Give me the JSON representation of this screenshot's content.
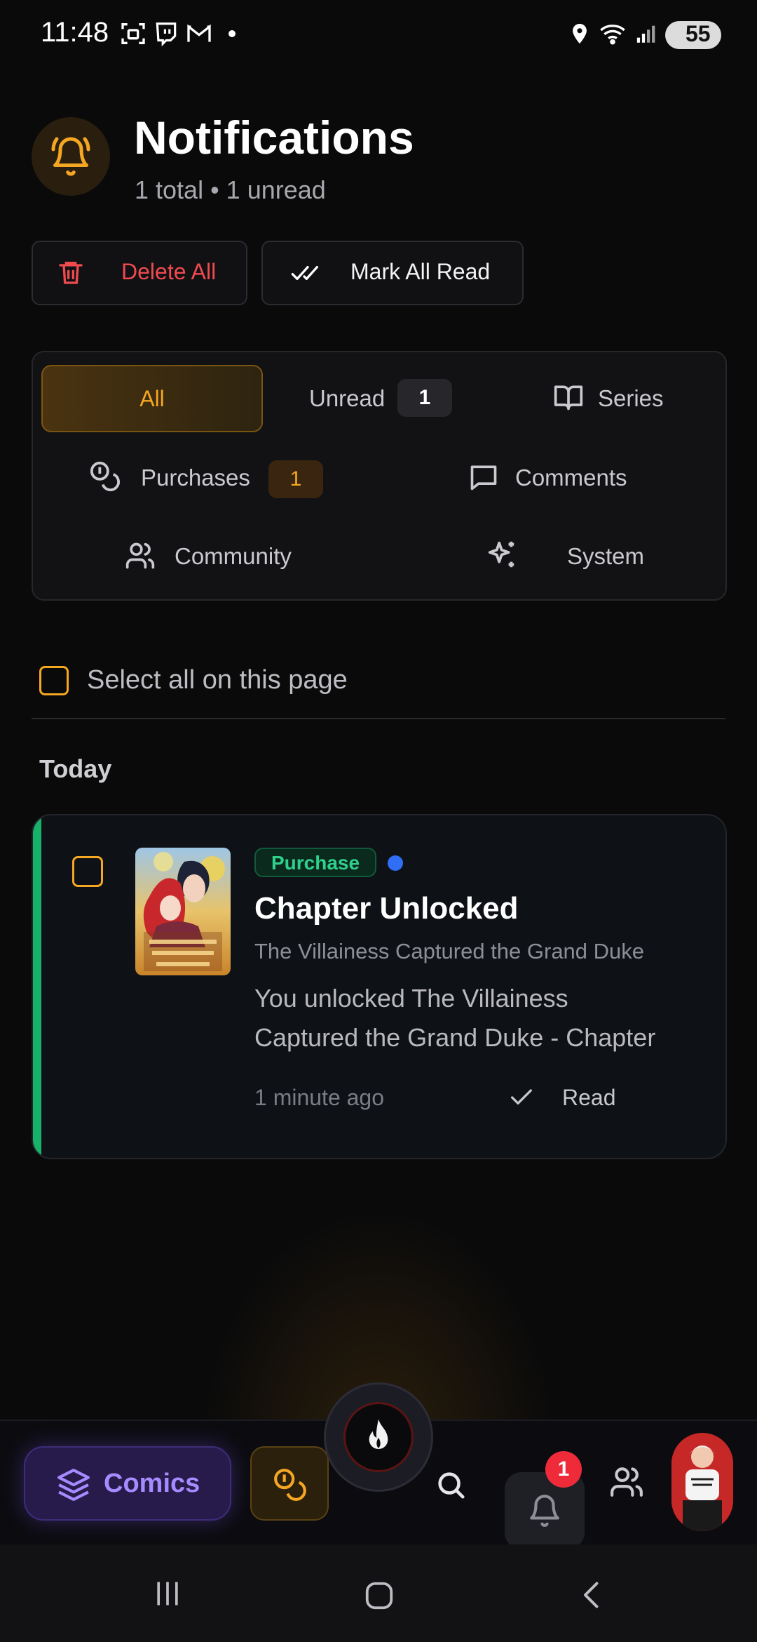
{
  "status_bar": {
    "time": "11:48",
    "battery": "55"
  },
  "header": {
    "title": "Notifications",
    "subtitle": "1 total • 1 unread"
  },
  "actions": {
    "delete_all": "Delete All",
    "mark_all_read": "Mark All Read"
  },
  "filters": {
    "all": "All",
    "unread": {
      "label": "Unread",
      "count": "1"
    },
    "series": "Series",
    "purchases": {
      "label": "Purchases",
      "count": "1"
    },
    "comments": "Comments",
    "community": "Community",
    "system": "System"
  },
  "select_all_label": "Select all on this page",
  "section": "Today",
  "notification": {
    "badge": "Purchase",
    "title": "Chapter Unlocked",
    "series": "The Villainess Captured the Grand Duke",
    "message_line1": "You unlocked The Villainess",
    "message_line2": "Captured the Grand Duke - Chapter",
    "time": "1 minute ago",
    "read_action": "Read"
  },
  "bottom_nav": {
    "comics": "Comics",
    "notifications_badge": "1"
  },
  "colors": {
    "accent": "#f5a623",
    "danger": "#f04a4f",
    "success": "#17b26a",
    "purple": "#a68bff"
  }
}
